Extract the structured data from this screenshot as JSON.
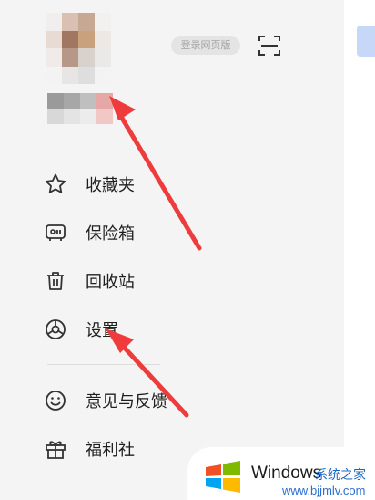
{
  "header": {
    "web_version_label": "登录网页版"
  },
  "menu": {
    "items": [
      {
        "label": "收藏夹",
        "icon": "star-icon"
      },
      {
        "label": "保险箱",
        "icon": "safe-box-icon"
      },
      {
        "label": "回收站",
        "icon": "trash-icon"
      },
      {
        "label": "设置",
        "icon": "settings-icon"
      },
      {
        "label": "意见与反馈",
        "icon": "smiley-feedback-icon"
      },
      {
        "label": "福利社",
        "icon": "gift-icon"
      }
    ]
  },
  "watermark": {
    "title": "Windows",
    "subtitle_cn": "系统之家",
    "url": "www.bjjmlv.com"
  },
  "colors": {
    "arrow": "#ee3b3b",
    "text": "#1f1f1f",
    "badge_bg": "#e4e4e4",
    "peek_accent": "#c7d7f8"
  }
}
